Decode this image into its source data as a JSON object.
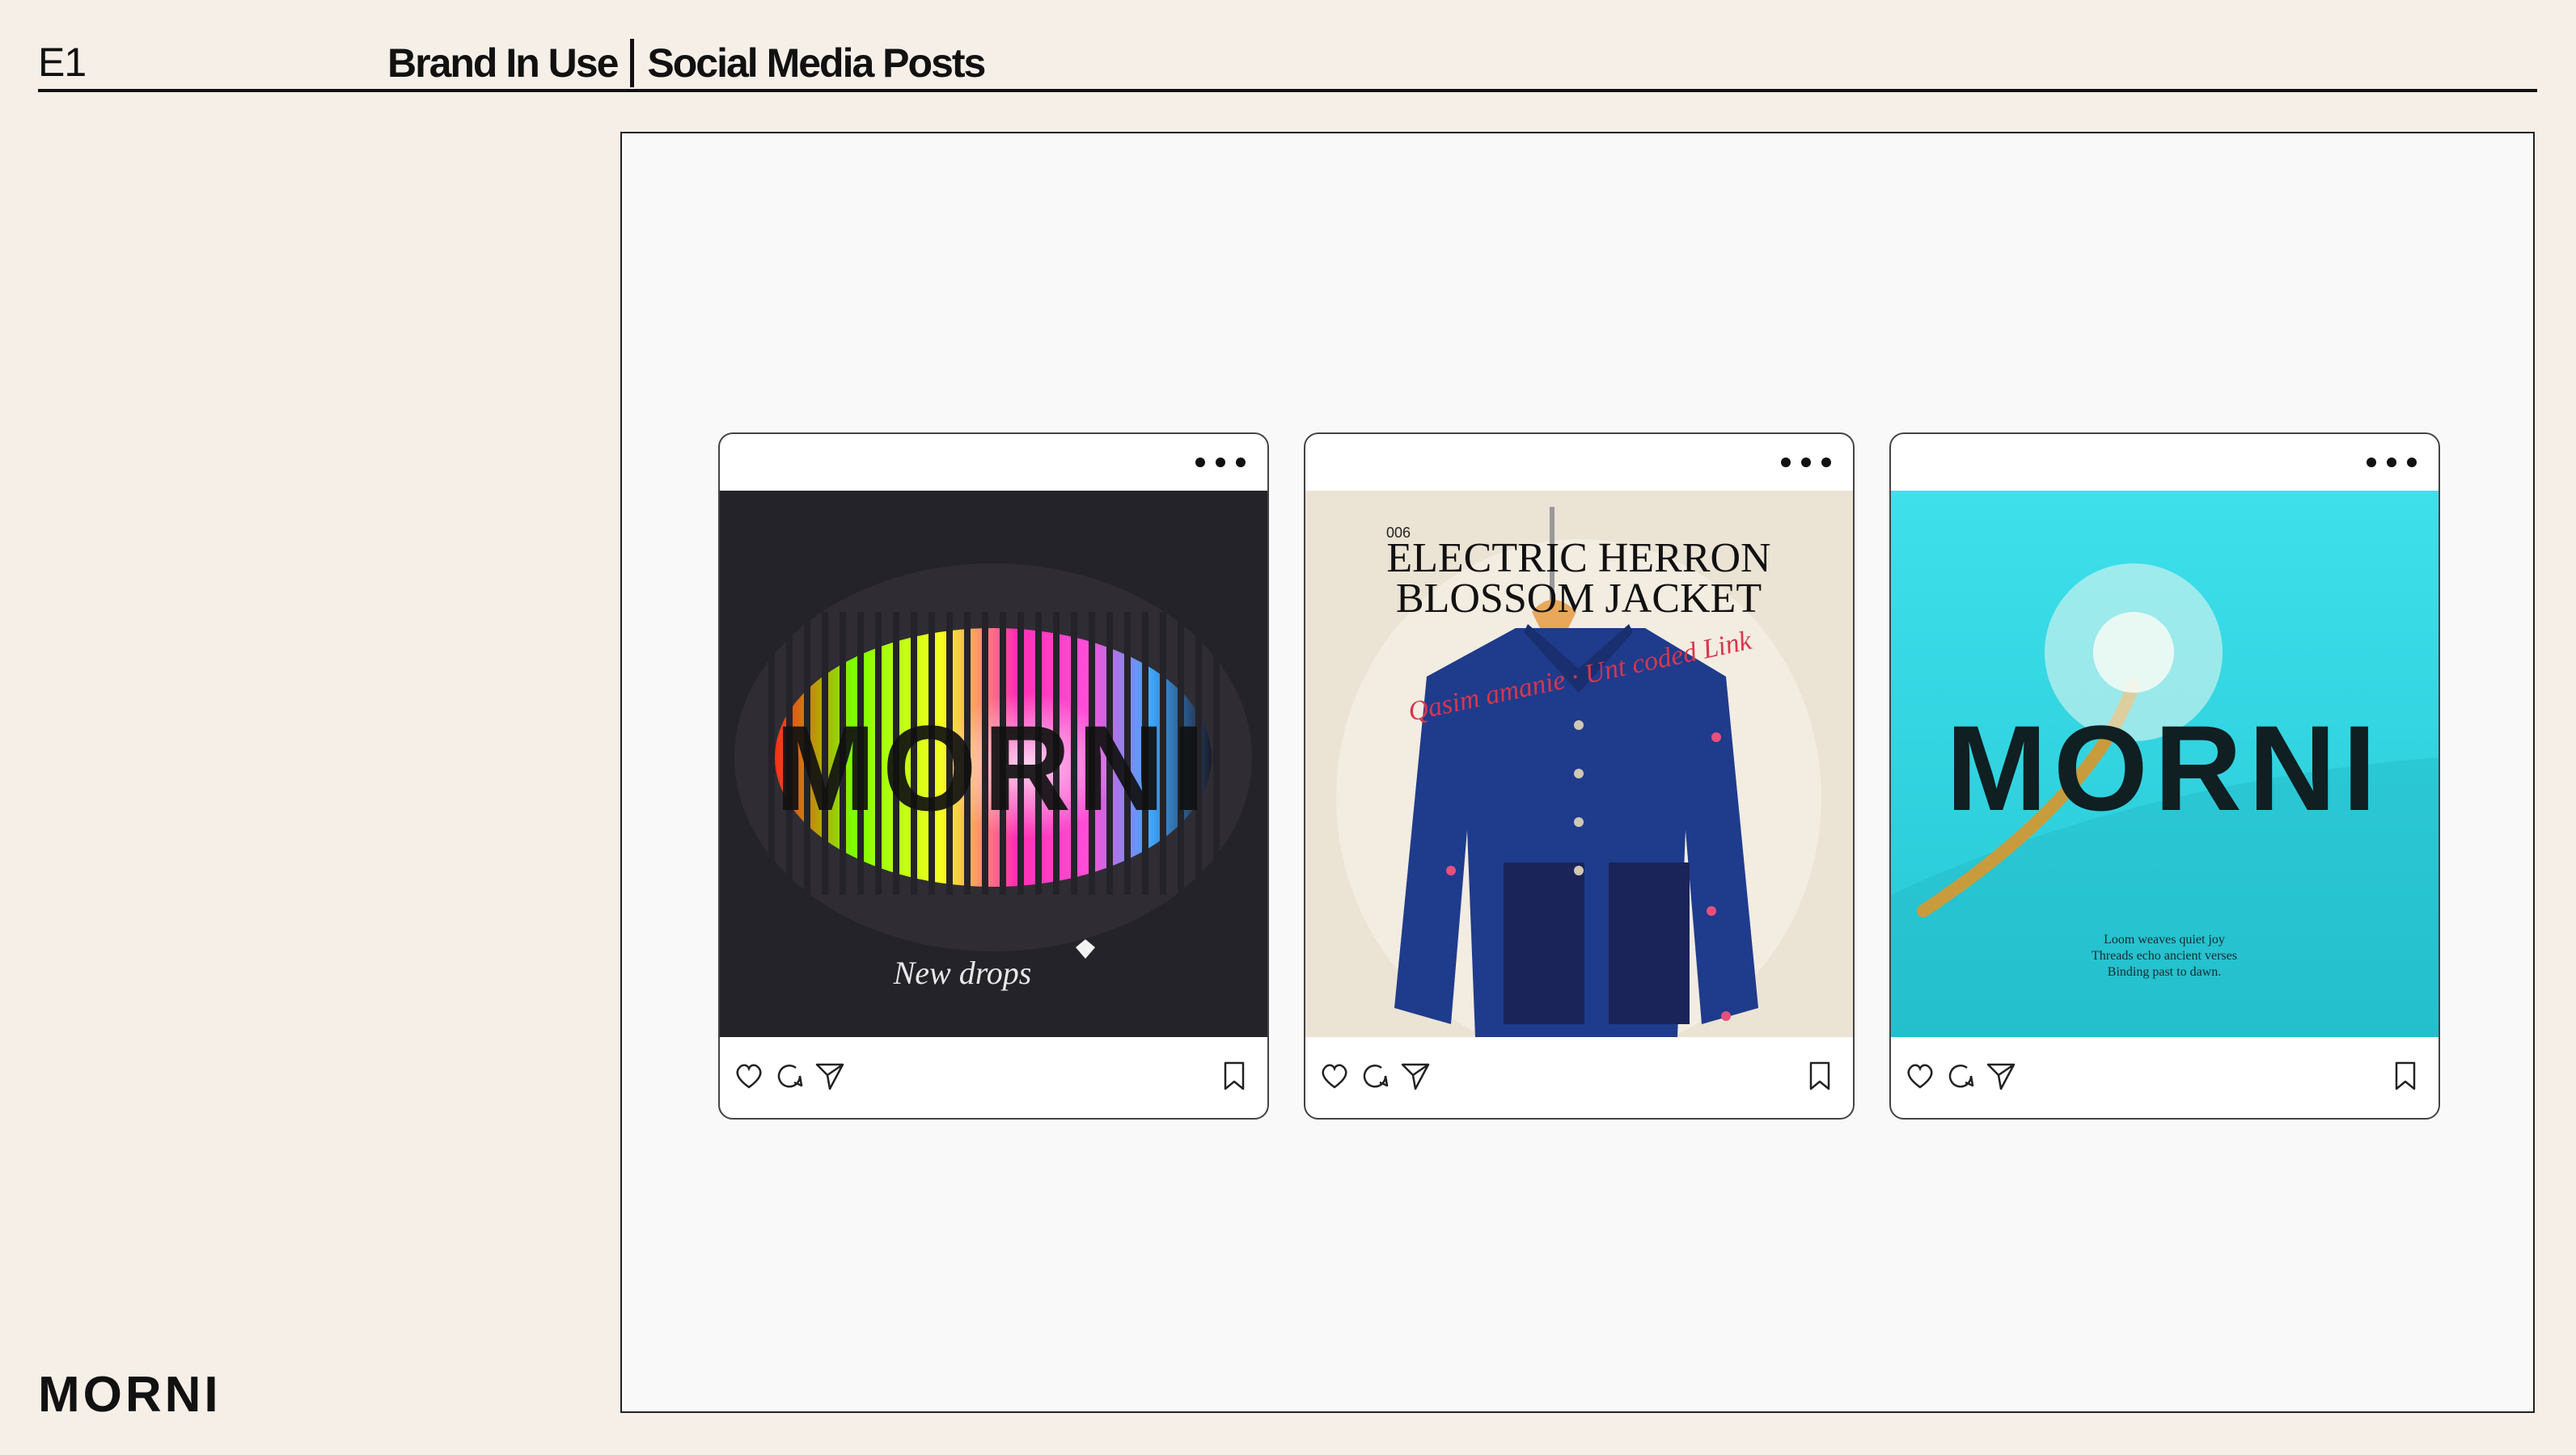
{
  "header": {
    "page_code": "E1",
    "section": "Brand In Use",
    "subsection": "Social Media Posts"
  },
  "footer": {
    "logo_text": "MORNI"
  },
  "posts": [
    {
      "brand_text": "MORNI",
      "caption": "New drops",
      "icons": [
        "more-icon",
        "heart-icon",
        "comment-icon",
        "share-icon",
        "bookmark-icon"
      ]
    },
    {
      "number": "006",
      "title_line1": "ELECTRIC HERRON",
      "title_line2": "BLOSSOM JACKET",
      "script_text": "Qasim amanie · Unt coded Link"
    },
    {
      "brand_text": "MORNI",
      "poem_line1": "Loom weaves quiet joy",
      "poem_line2": "Threads echo ancient verses",
      "poem_line3": "Binding past to dawn."
    }
  ],
  "colors": {
    "background": "#f5efe7",
    "canvas": "#f9f9f9",
    "ink": "#111111",
    "turquoise": "#2fd3dc",
    "denim": "#1e3a8a"
  }
}
